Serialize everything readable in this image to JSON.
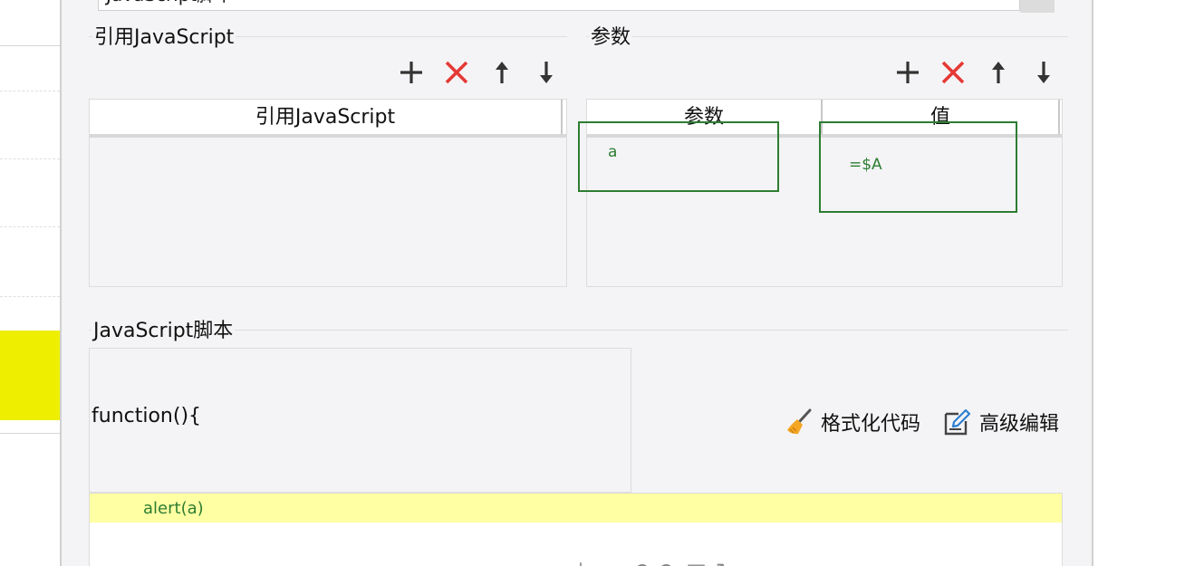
{
  "top_input": {
    "value": "JavaScript脚本"
  },
  "ref_js": {
    "title": "引用JavaScript",
    "column": "引用JavaScript",
    "toolbar": [
      "add-icon",
      "delete-icon",
      "move-up-icon",
      "move-down-icon"
    ]
  },
  "params": {
    "title": "参数",
    "columns": [
      "参数",
      "值"
    ],
    "rows": [
      {
        "name": "a",
        "value": "=$A"
      }
    ],
    "toolbar": [
      "add-icon",
      "delete-icon",
      "move-up-icon",
      "move-down-icon"
    ]
  },
  "script": {
    "title": "JavaScript脚本",
    "header_line": "function(){",
    "body_line": "alert(a)",
    "format_label": "格式化代码",
    "advanced_label": "高级编辑"
  },
  "colors": {
    "accent_green": "#2e7d32",
    "delete_red": "#e53935",
    "highlight_line": "#ffffa3",
    "panel_bg": "#f4f4f6"
  }
}
